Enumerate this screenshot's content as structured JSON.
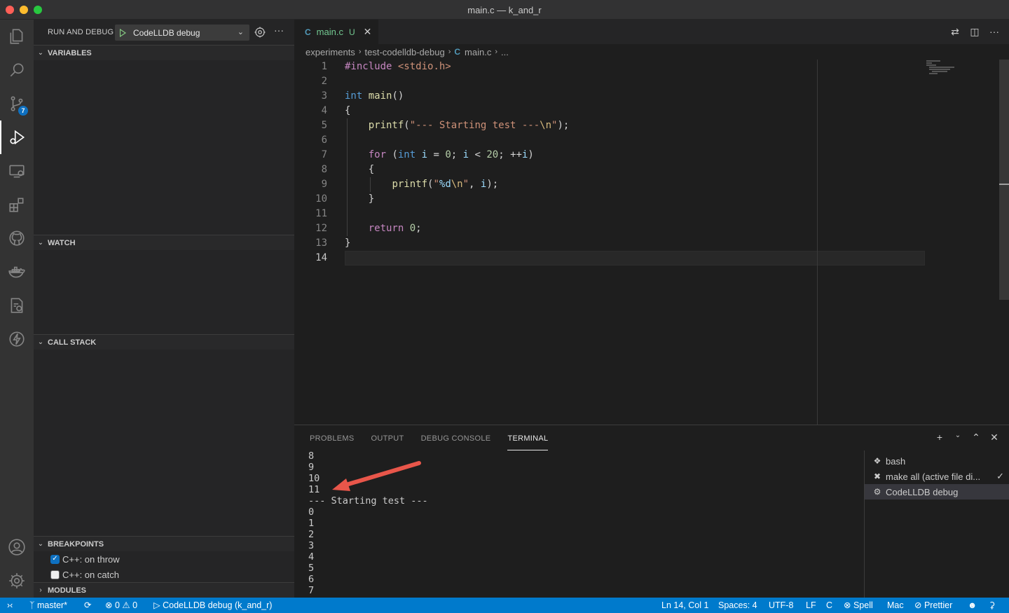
{
  "window": {
    "title": "main.c — k_and_r"
  },
  "activity_bar": {
    "items": [
      {
        "name": "explorer-icon"
      },
      {
        "name": "search-icon"
      },
      {
        "name": "source-control-icon",
        "badge": "7"
      },
      {
        "name": "run-debug-icon"
      },
      {
        "name": "remote-explorer-icon"
      },
      {
        "name": "extensions-icon"
      },
      {
        "name": "github-icon"
      },
      {
        "name": "docker-icon"
      },
      {
        "name": "remote-settings-icon"
      },
      {
        "name": "lightning-icon"
      }
    ],
    "bottom": [
      {
        "name": "account-icon"
      },
      {
        "name": "manage-gear-icon"
      }
    ]
  },
  "sidebar": {
    "title": "RUN AND DEBUG",
    "launch_config": "CodeLLDB debug",
    "more": "···",
    "sections": {
      "variables": "VARIABLES",
      "watch": "WATCH",
      "call_stack": "CALL STACK",
      "breakpoints": "BREAKPOINTS",
      "modules": "MODULES"
    },
    "breakpoints": [
      {
        "label": "C++: on throw",
        "checked": true
      },
      {
        "label": "C++: on catch",
        "checked": false
      }
    ]
  },
  "editor": {
    "tab": {
      "icon": "C",
      "name": "main.c",
      "status": "U"
    },
    "breadcrumb": [
      "experiments",
      "test-codelldb-debug",
      "main.c",
      "..."
    ],
    "breadcrumb_icon": "C",
    "line_numbers": [
      "1",
      "2",
      "3",
      "4",
      "5",
      "6",
      "7",
      "8",
      "9",
      "10",
      "11",
      "12",
      "13",
      "14"
    ],
    "current_line": "14"
  },
  "panel": {
    "tabs": [
      "PROBLEMS",
      "OUTPUT",
      "DEBUG CONSOLE",
      "TERMINAL"
    ],
    "active_tab": "TERMINAL",
    "terminal_output": [
      "8",
      "9",
      "10",
      "11",
      "--- Starting test ---",
      "0",
      "1",
      "2",
      "3",
      "4",
      "5",
      "6",
      "7"
    ],
    "terminals": [
      {
        "label": "bash",
        "icon": "terminal-bash-icon"
      },
      {
        "label": "make all (active file di...",
        "icon": "tools-icon",
        "done": "✓"
      },
      {
        "label": "CodeLLDB debug",
        "icon": "debug-icon",
        "selected": true
      }
    ]
  },
  "statusbar": {
    "branch": "master*",
    "errors": "0",
    "warnings": "0",
    "debug_session": "CodeLLDB debug (k_and_r)",
    "position": "Ln 14, Col 1",
    "spaces": "Spaces: 4",
    "encoding": "UTF-8",
    "eol": "LF",
    "language": "C",
    "spell": "Spell",
    "platform": "Mac",
    "prettier": "Prettier"
  },
  "colors": {
    "accent": "#007acc",
    "annotation_arrow": "#e8564a"
  }
}
